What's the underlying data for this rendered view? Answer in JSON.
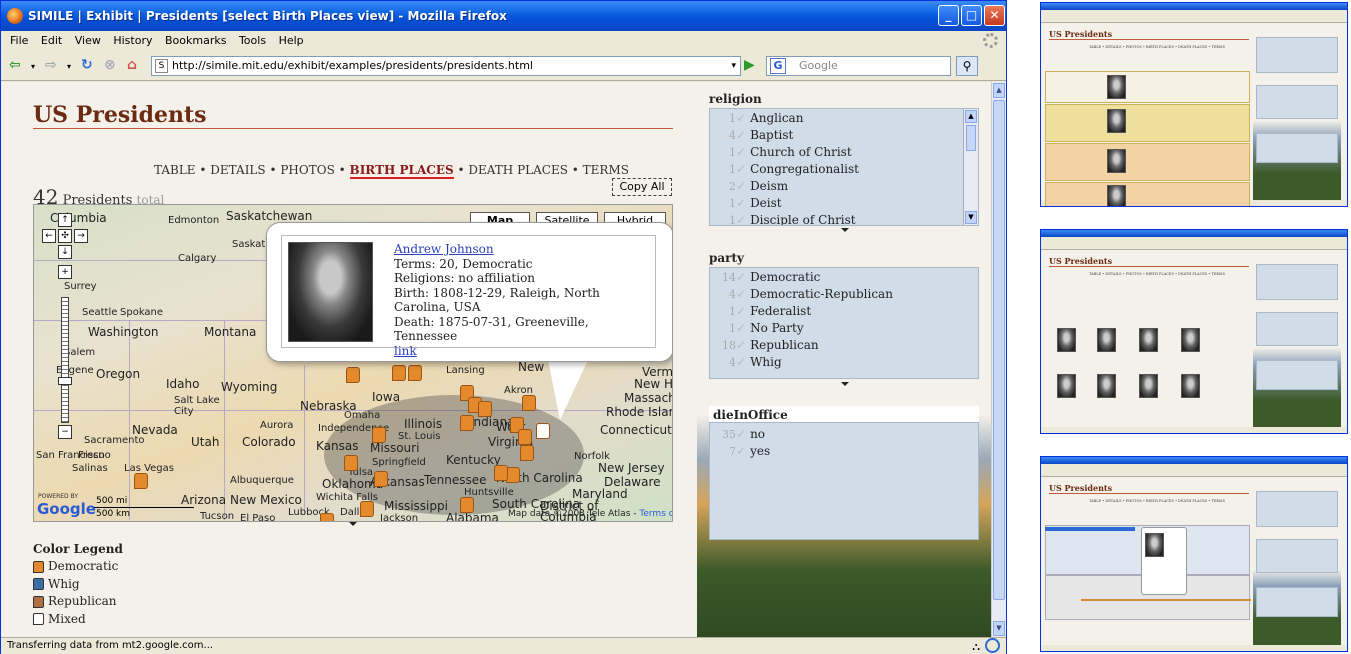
{
  "window": {
    "title": "SIMILE | Exhibit | Presidents [select Birth Places view] - Mozilla Firefox"
  },
  "menu": [
    "File",
    "Edit",
    "View",
    "History",
    "Bookmarks",
    "Tools",
    "Help"
  ],
  "nav": {
    "url": "http://simile.mit.edu/exhibit/examples/presidents/presidents.html",
    "search_placeholder": "Google"
  },
  "page": {
    "title": "US Presidents",
    "views": {
      "table": "TABLE",
      "details": "DETAILS",
      "photos": "PHOTOS",
      "birth_places": "BIRTH PLACES",
      "death_places": "DEATH PLACES",
      "terms": "TERMS",
      "sep": "•"
    },
    "count": "42",
    "count_label": "Presidents",
    "count_total": "total",
    "copy_all": "Copy All"
  },
  "map": {
    "types": [
      "Map",
      "Satellite",
      "Hybrid"
    ],
    "powered_by": "POWERED BY",
    "logo": "Google",
    "scale_mi": "500 mi",
    "scale_km": "500 km",
    "map_data": "Map data ©2008 Tele Atlas -",
    "terms_link": "Terms of Use",
    "cities": [
      {
        "name": "Columbia",
        "big": true
      },
      {
        "name": "Edmonton"
      },
      {
        "name": "Saskatchewan",
        "big": true
      },
      {
        "name": "Saskatoon"
      },
      {
        "name": "Calgary"
      },
      {
        "name": "Surrey"
      },
      {
        "name": "Seattle"
      },
      {
        "name": "Spokane"
      },
      {
        "name": "Washington",
        "big": true
      },
      {
        "name": "Montana",
        "big": true
      },
      {
        "name": "Salem"
      },
      {
        "name": "Oregon",
        "big": true
      },
      {
        "name": "Eugene"
      },
      {
        "name": "Idaho",
        "big": true
      },
      {
        "name": "Wyoming",
        "big": true
      },
      {
        "name": "Salt Lake City"
      },
      {
        "name": "Nevada",
        "big": true
      },
      {
        "name": "Utah",
        "big": true
      },
      {
        "name": "Colorado",
        "big": true
      },
      {
        "name": "Aurora"
      },
      {
        "name": "Sacramento"
      },
      {
        "name": "San Francisco"
      },
      {
        "name": "Fresno"
      },
      {
        "name": "Salinas"
      },
      {
        "name": "Las Vegas"
      },
      {
        "name": "Arizona",
        "big": true
      },
      {
        "name": "New Mexico",
        "big": true
      },
      {
        "name": "Albuquerque"
      },
      {
        "name": "Tucson"
      },
      {
        "name": "El Paso"
      },
      {
        "name": "Lubbock"
      },
      {
        "name": "Dallas"
      },
      {
        "name": "Wichita Falls"
      },
      {
        "name": "Tulsa"
      },
      {
        "name": "Oklahoma",
        "big": true
      },
      {
        "name": "Kansas",
        "big": true
      },
      {
        "name": "Independence"
      },
      {
        "name": "Nebraska",
        "big": true
      },
      {
        "name": "Omaha"
      },
      {
        "name": "Iowa",
        "big": true
      },
      {
        "name": "Illinois",
        "big": true
      },
      {
        "name": "Indiana",
        "big": true
      },
      {
        "name": "Missouri",
        "big": true
      },
      {
        "name": "St. Louis"
      },
      {
        "name": "Springfield"
      },
      {
        "name": "Kentucky",
        "big": true
      },
      {
        "name": "Tennessee",
        "big": true
      },
      {
        "name": "Huntsville"
      },
      {
        "name": "Mississippi",
        "big": true
      },
      {
        "name": "Alabama",
        "big": true
      },
      {
        "name": "Jackson"
      },
      {
        "name": "Arkansas",
        "big": true
      },
      {
        "name": "Virginia",
        "big": true
      },
      {
        "name": "West",
        "big": true
      },
      {
        "name": "North Carolina",
        "big": true
      },
      {
        "name": "South Carolina",
        "big": true
      },
      {
        "name": "Norfolk"
      },
      {
        "name": "New Jersey",
        "big": true
      },
      {
        "name": "Delaware",
        "big": true
      },
      {
        "name": "Maryland",
        "big": true
      },
      {
        "name": "District of Columbia",
        "big": true
      },
      {
        "name": "Connecticut",
        "big": true
      },
      {
        "name": "Rhode Island",
        "big": true
      },
      {
        "name": "Massachu",
        "big": true
      },
      {
        "name": "New Ha",
        "big": true
      },
      {
        "name": "Vermo",
        "big": true
      },
      {
        "name": "New",
        "big": true
      },
      {
        "name": "Akron"
      },
      {
        "name": "Lansing"
      }
    ]
  },
  "bubble": {
    "name": "Andrew Johnson",
    "terms": "Terms: 20, Democratic",
    "religions": "Religions: no affiliation",
    "birth": "Birth: 1808-12-29, Raleigh, North Carolina, USA",
    "death": "Death: 1875-07-31, Greeneville, Tennessee",
    "link": "link"
  },
  "legend": {
    "title": "Color Legend",
    "items": [
      {
        "label": "Democratic",
        "color": "#e48a2c"
      },
      {
        "label": "Whig",
        "color": "#3a6ea5"
      },
      {
        "label": "Republican",
        "color": "#b07040"
      },
      {
        "label": "Mixed",
        "color": "#ffffff"
      }
    ]
  },
  "facets": {
    "religion": {
      "title": "religion",
      "items": [
        {
          "count": "1",
          "label": "Anglican"
        },
        {
          "count": "4",
          "label": "Baptist"
        },
        {
          "count": "1",
          "label": "Church of Christ"
        },
        {
          "count": "1",
          "label": "Congregationalist"
        },
        {
          "count": "2",
          "label": "Deism"
        },
        {
          "count": "1",
          "label": "Deist"
        },
        {
          "count": "1",
          "label": "Disciple of Christ"
        }
      ]
    },
    "party": {
      "title": "party",
      "items": [
        {
          "count": "14",
          "label": "Democratic"
        },
        {
          "count": "4",
          "label": "Democratic-Republican"
        },
        {
          "count": "1",
          "label": "Federalist"
        },
        {
          "count": "1",
          "label": "No Party"
        },
        {
          "count": "18",
          "label": "Republican"
        },
        {
          "count": "4",
          "label": "Whig"
        }
      ]
    },
    "dieInOffice": {
      "title": "dieInOffice",
      "items": [
        {
          "count": "35",
          "label": "no"
        },
        {
          "count": "7",
          "label": "yes"
        }
      ]
    }
  },
  "status": "Transferring data from mt2.google.com...",
  "thumbs": [
    {
      "title": "US Presidents",
      "views": "TABLE • DETAILS • PHOTOS • BIRTH PLACES • DEATH PLACES • TERMS"
    },
    {
      "title": "US Presidents",
      "views": "TABLE • DETAILS • PHOTOS • BIRTH PLACES • DEATH PLACES • TERMS"
    },
    {
      "title": "US Presidents",
      "views": "TABLE • DETAILS • PHOTOS • BIRTH PLACES • DEATH PLACES • TERMS"
    }
  ]
}
